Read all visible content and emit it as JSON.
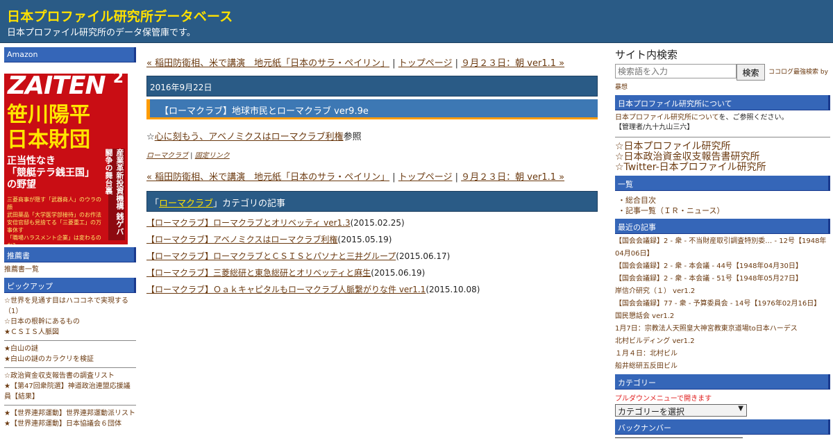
{
  "header": {
    "title": "日本プロファイル研究所データベース",
    "description": "日本プロファイル研究所のデータ保管庫です。"
  },
  "left": {
    "amazon_head": "Amazon",
    "book": {
      "brand": "ZAITEN",
      "issue": "2",
      "headline": "笹川陽平\n日本財団",
      "sub": "正当性なき\n「競艇テラ銭王国」\nの野望",
      "side_text": "産業革新投資機構 銭ゲバ闘争の舞台裏",
      "lines": "三菱商事が隠す「武器商人」のウラの顔\n武田薬品「大学医学部接待」のお作法\n安倍官邸も見捨てる「三菱重工」の万事休す\n「職場ハラスメント企業」は変わるのか?\nあきれた広報実話大賞は「商事製薬」に決定!"
    },
    "recommend_head": "推薦書",
    "recommend_link": "推薦書一覧",
    "pickup_head": "ピックアップ",
    "pickup_groups": [
      [
        "☆世界を見通す目はハココネで実現する（1）",
        "☆日本の根幹にあるもの",
        "★ＣＳＩＳ人脈図"
      ],
      [
        "★白山の謎",
        "★白山の謎のカラクリを検証"
      ],
      [
        "☆政治資金収支報告書の調査リスト",
        "★【第47回衆院選】神道政治連盟応援議員【結果】"
      ],
      [
        "★【世界連邦運動】世界連邦運動派リスト",
        "★【世界連邦運動】日本協議会６団体"
      ]
    ]
  },
  "main": {
    "nav": {
      "prev": "« 稲田防衛相、米で講演　地元紙「日本のサラ・ペイリン」",
      "sep1": " | ",
      "top": "トップページ",
      "sep2": " | ",
      "next": "９月２３日：朝 ver1.1 »"
    },
    "date": "2016年9月22日",
    "entry_title": "【ローマクラブ】地球市民とローマクラブ ver9.9e",
    "entry_body_prefix": "☆",
    "entry_body_link": "心に刻もう、アベノミクスはローマクラブ利権",
    "entry_body_suffix": "参照",
    "meta_category": "ローマクラブ",
    "meta_sep": " | ",
    "meta_permalink": "固定リンク",
    "cat_bar_open": "「",
    "cat_bar_link": "ローマクラブ",
    "cat_bar_close": "」カテゴリの記事",
    "cat_articles": [
      {
        "title": "【ローマクラブ】ローマクラブとオリベッティ ver1.3",
        "date": "(2015.02.25)"
      },
      {
        "title": "【ローマクラブ】アベノミクスはローマクラブ利権",
        "date": "(2015.05.19)"
      },
      {
        "title": "【ローマクラブ】ローマクラブとＣＳＩＳとパソナと三井グループ",
        "date": "(2015.06.17)"
      },
      {
        "title": "【ローマクラブ】三菱総研と東急総研とオリベッティと麻生",
        "date": "(2015.06.19)"
      },
      {
        "title": "【ローマクラブ】Ｏａｋキャピタルもローマクラブ人脈繋がりな件 ver1.1",
        "date": "(2015.10.08)"
      }
    ]
  },
  "right": {
    "search_title": "サイト内検索",
    "search_placeholder": "検索語を入力",
    "search_button": "検索",
    "search_note": "ココログ最強検索 by",
    "search_note2": "暴想",
    "about_head": "日本プロファイル研究所について",
    "about_link": "日本プロファイル研究所について",
    "about_text": "を、ご参照ください。",
    "about_admin": "【管理者/九十九山三六】",
    "big_links": [
      "☆日本プロファイル研究所",
      "☆日本政治資金収支報告書研究所",
      "☆Twitter-日本プロファイル研究所"
    ],
    "list_head": "一覧",
    "list_items": [
      "・総合目次",
      "・記事一覧（ＩＲ・ニュース）"
    ],
    "recent_head": "最近の記事",
    "recent_items": [
      "【国会会議録】2 - 衆 - 不当財産取引調査特別委… - 12号【1948年04月06日】",
      "【国会会議録】2 - 衆 - 本会議 - 44号【1948年04月30日】",
      "【国会会議録】2 - 衆 - 本会議 - 51号【1948年05月27日】",
      "岸信介研究（１） ver1.2",
      "【国会会議録】77 - 衆 - 予算委員会 - 14号【1976年02月16日】",
      "国民懇話会 ver1.2",
      "1月7日：宗教法人天照皇大神宮教東京道場to日本ハーデス",
      "北村ビルディング ver1.2",
      "１月４日：北村ビル",
      "船井総研五反田ビル"
    ],
    "category_head": "カテゴリー",
    "pulldown_text": "プルダウンメニューで開きます",
    "category_select": "カテゴリーを選択",
    "backnumber_head": "バックナンバー"
  }
}
